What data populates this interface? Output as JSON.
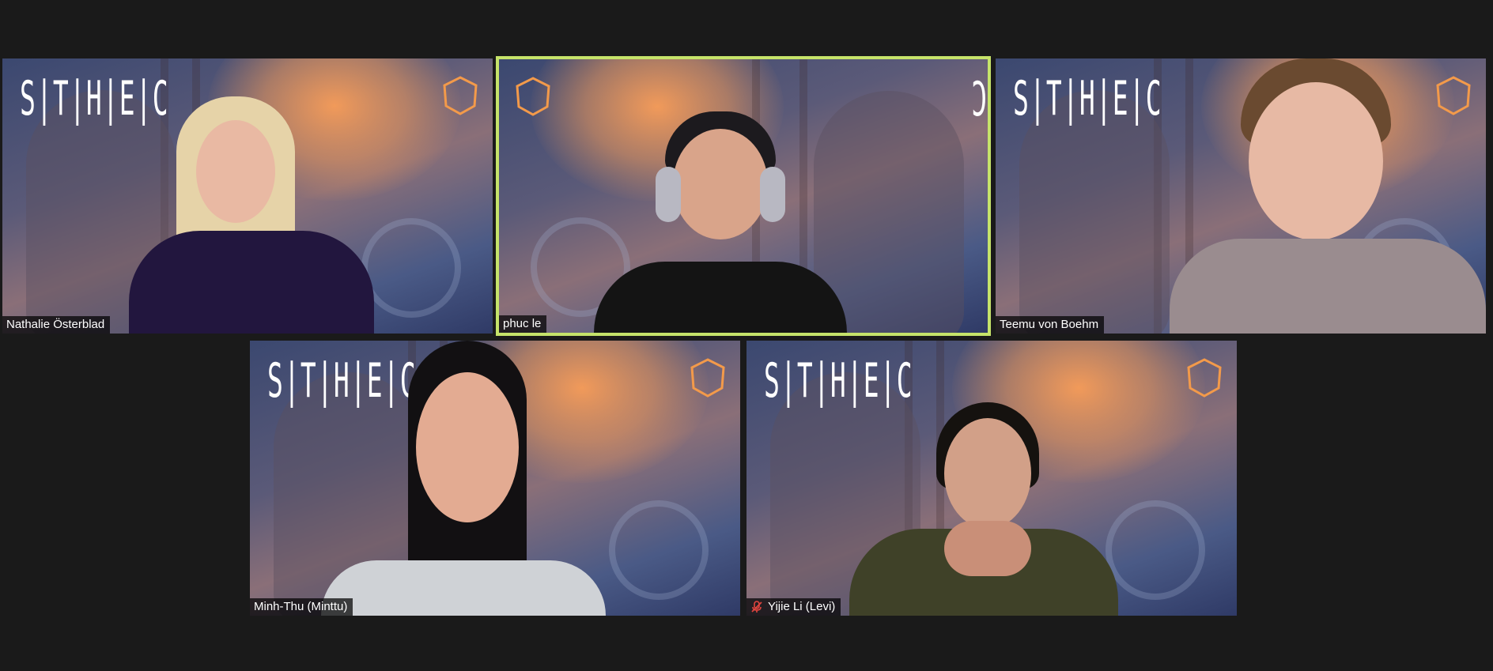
{
  "brand_logo_text": "STHEC",
  "participants": [
    {
      "name": "Nathalie Österblad",
      "muted": false,
      "active_speaker": false
    },
    {
      "name": "phuc le",
      "muted": false,
      "active_speaker": true
    },
    {
      "name": "Teemu von Boehm",
      "muted": false,
      "active_speaker": false
    },
    {
      "name": "Minh-Thu (Minttu)",
      "muted": false,
      "active_speaker": false
    },
    {
      "name": "Yijie Li (Levi)",
      "muted": true,
      "active_speaker": false
    }
  ],
  "colors": {
    "active_speaker_border": "#c6e36a",
    "muted_icon": "#e0443e",
    "background": "#1a1a1a",
    "badge_orange": "#f39a4a"
  },
  "icons": {
    "mic_muted": "microphone-muted-icon",
    "badge": "academy-badge-icon"
  }
}
